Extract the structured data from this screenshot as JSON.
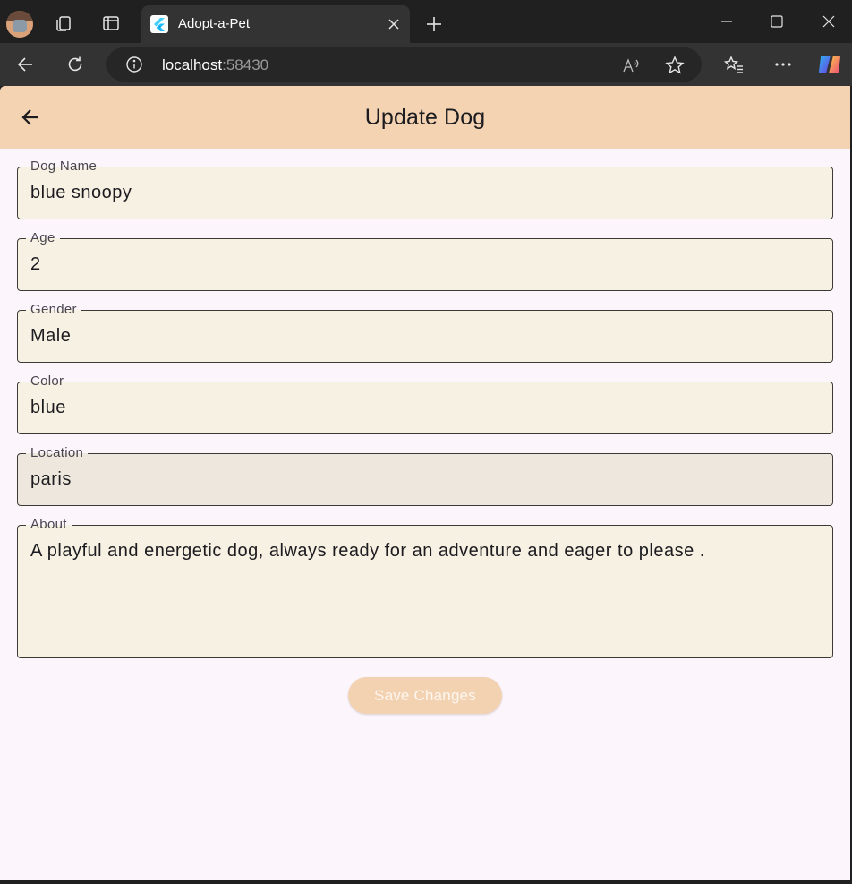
{
  "browser": {
    "tab_title": "Adopt-a-Pet",
    "url_host": "localhost",
    "url_port": ":58430"
  },
  "appbar": {
    "title": "Update Dog"
  },
  "form": {
    "dog_name": {
      "label": "Dog Name",
      "value": "blue snoopy"
    },
    "age": {
      "label": "Age",
      "value": "2"
    },
    "gender": {
      "label": "Gender",
      "value": "Male"
    },
    "color": {
      "label": "Color",
      "value": "blue"
    },
    "location": {
      "label": "Location",
      "value": "paris"
    },
    "about": {
      "label": "About",
      "value": "A playful and energetic dog, always ready for an adventure and eager to please ."
    },
    "save_label": "Save Changes"
  },
  "colors": {
    "appbar": "#f3d3b1",
    "page_bg": "#fcf5fb",
    "field_bg": "#f7f1e3",
    "field_bg_hover": "#ede7dd",
    "button_bg": "#f2d2b1"
  }
}
